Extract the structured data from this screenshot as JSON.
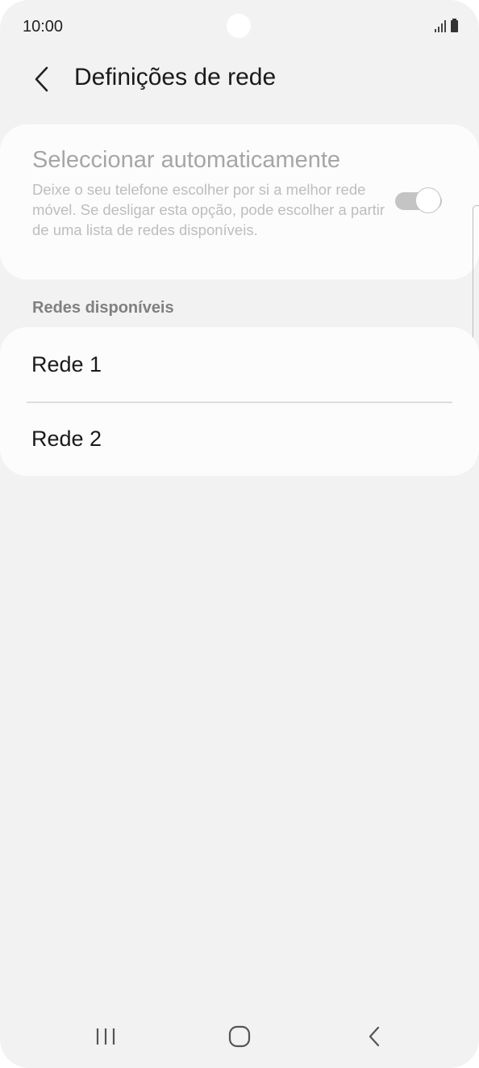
{
  "status_bar": {
    "time": "10:00",
    "signal_icon": "signal-bars-icon",
    "battery_icon": "battery-icon"
  },
  "header": {
    "back_icon": "chevron-left-icon",
    "title": "Definições de rede"
  },
  "auto_select": {
    "title": "Seleccionar automaticamente",
    "description": "Deixe o seu telefone escolher por si a melhor rede móvel. Se desligar esta opção, pode escolher a partir de uma lista de redes disponíveis.",
    "toggle_on": true,
    "enabled": false
  },
  "networks": {
    "section_title": "Redes disponíveis",
    "items": [
      {
        "label": "Rede 1"
      },
      {
        "label": "Rede 2"
      }
    ]
  },
  "nav_bar": {
    "recents_icon": "recent-apps-icon",
    "home_icon": "home-icon",
    "back_icon": "back-icon"
  },
  "colors": {
    "background": "#f2f2f2",
    "card": "#fcfcfc",
    "disabled_text": "#a6a6a6",
    "primary_text": "#1a1a1a",
    "section_text": "#808080"
  }
}
